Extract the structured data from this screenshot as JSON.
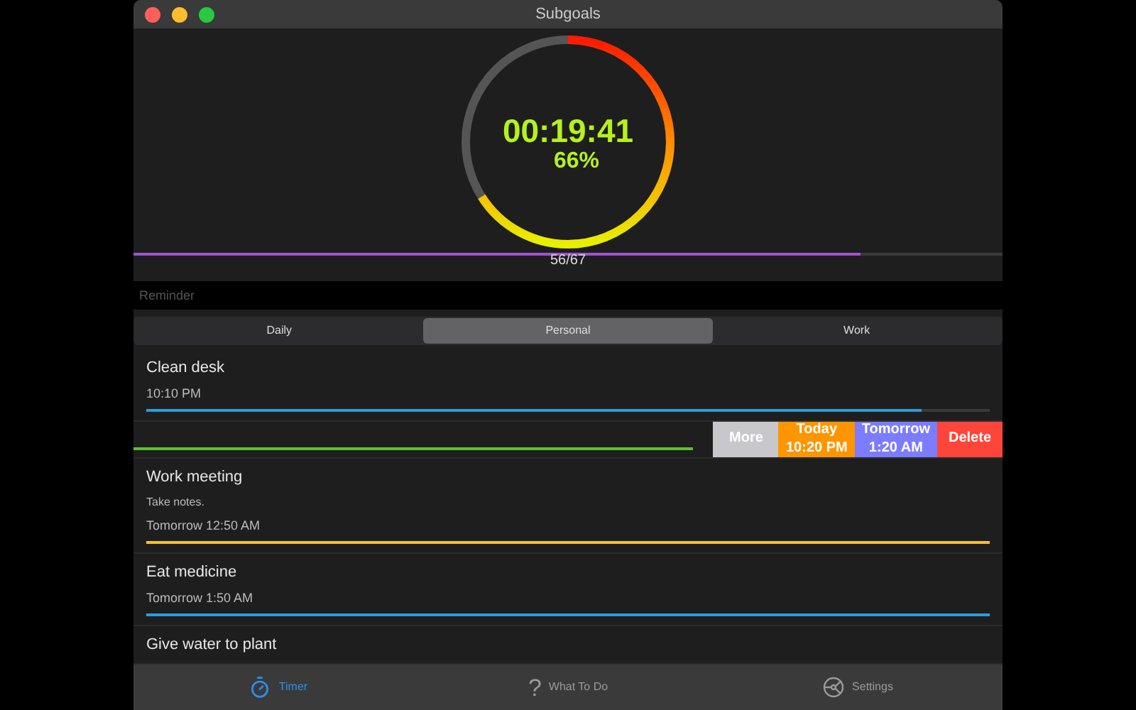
{
  "window": {
    "title": "Subgoals"
  },
  "timer": {
    "time": "00:19:41",
    "percent": "66%",
    "level": 0.66
  },
  "progress": {
    "level": 0.836,
    "reading": "56/67"
  },
  "reminder": {
    "placeholder": "Reminder"
  },
  "segments": [
    {
      "label": "Daily",
      "selected": false
    },
    {
      "label": "Personal",
      "selected": true
    },
    {
      "label": "Work",
      "selected": false
    }
  ],
  "tasks": [
    {
      "kind": "task",
      "title": "Clean desk",
      "time": "10:10 PM",
      "color": "#2d9cdb",
      "level": 0.92
    },
    {
      "kind": "swiped",
      "color": "#5cc230",
      "level": 1,
      "actions": [
        {
          "label": "More",
          "color": "#c8c8cc"
        },
        {
          "label": "Today\n10:20 PM",
          "color": "#ff9500"
        },
        {
          "label": "Tomorrow\n1:20 AM",
          "color": "#7b7cff"
        },
        {
          "label": "Delete",
          "color": "#ff453a"
        }
      ]
    },
    {
      "kind": "task",
      "title": "Work meeting",
      "note": "Take notes.",
      "time": "Tomorrow 12:50 AM",
      "color": "#f2c230",
      "level": 1
    },
    {
      "kind": "task",
      "title": "Eat medicine",
      "time": "Tomorrow 1:50 AM",
      "color": "#2d9cdb",
      "level": 1
    },
    {
      "kind": "task",
      "title": "Give water to plant"
    }
  ],
  "tab_bar": [
    {
      "kind": "timer",
      "label": "Timer",
      "selected": true
    },
    {
      "kind": "help",
      "glyph": "?",
      "label": "What To Do",
      "selected": false
    },
    {
      "kind": "settings",
      "label": "Settings",
      "selected": false
    }
  ]
}
